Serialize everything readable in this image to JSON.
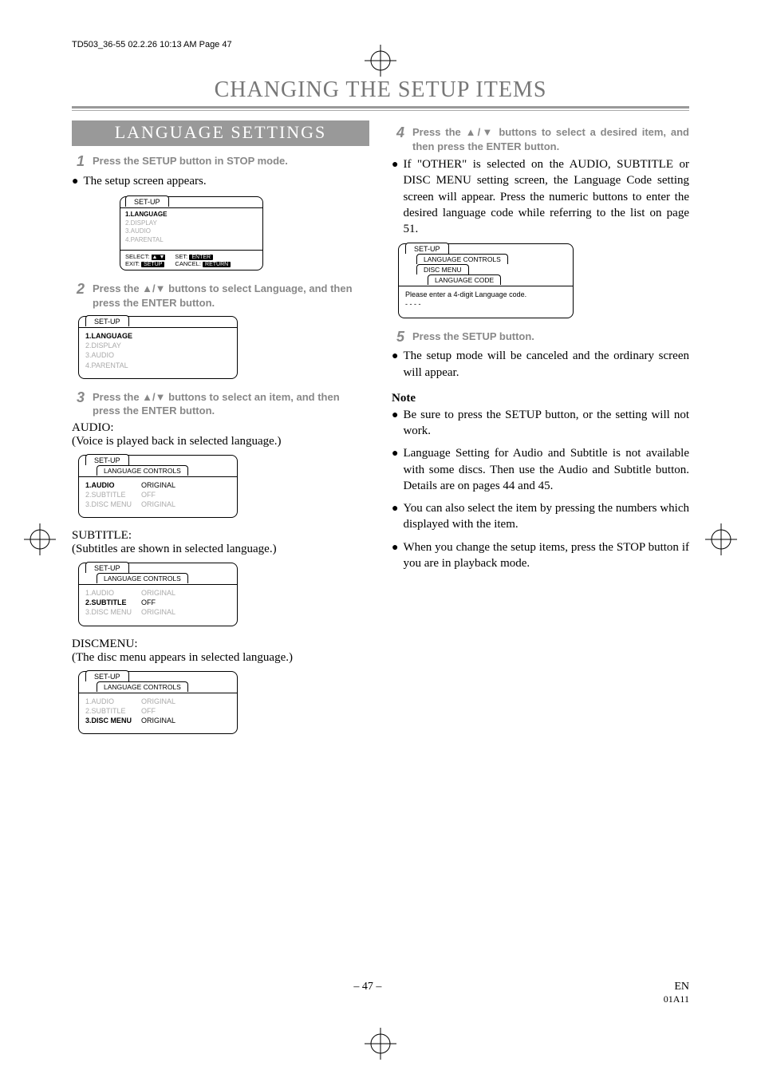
{
  "header_line": "TD503_36-55  02.2.26  10:13 AM  Page 47",
  "main_title": "CHANGING THE SETUP ITEMS",
  "banner": "LANGUAGE SETTINGS",
  "step1": {
    "num": "1",
    "text": "Press the SETUP button in STOP mode."
  },
  "bullet1": "The setup screen appears.",
  "osd_main": {
    "title": "SET-UP",
    "items": [
      "1.LANGUAGE",
      "2.DISPLAY",
      "3.AUDIO",
      "4.PARENTAL"
    ],
    "foot_select": "SELECT:",
    "foot_set": "SET:",
    "foot_exit": "EXIT:",
    "foot_cancel": "CANCEL:",
    "btn_enter": "ENTER",
    "btn_setup": "SETUP",
    "btn_return": "RETURN"
  },
  "step2": {
    "num": "2",
    "text_a": "Press the ",
    "text_b": " buttons to select Language, and then press the ENTER button."
  },
  "osd_step2": {
    "title": "SET-UP",
    "items": [
      {
        "t": "1.LANGUAGE",
        "active": true
      },
      {
        "t": "2.DISPLAY",
        "active": false
      },
      {
        "t": "3.AUDIO",
        "active": false
      },
      {
        "t": "4.PARENTAL",
        "active": false
      }
    ]
  },
  "step3": {
    "num": "3",
    "text_a": "Press the ",
    "text_b": " buttons to select an item, and then press the ENTER button."
  },
  "audio_block": {
    "label": "AUDIO:",
    "desc": "(Voice is played back in selected language.)",
    "osd_title": "SET-UP",
    "osd_sub": "LANGUAGE CONTROLS",
    "rows": [
      {
        "label": "1.AUDIO",
        "val": "ORIGINAL",
        "active": true
      },
      {
        "label": "2.SUBTITLE",
        "val": "OFF",
        "active": false
      },
      {
        "label": "3.DISC MENU",
        "val": "ORIGINAL",
        "active": false
      }
    ]
  },
  "subtitle_block": {
    "label": "SUBTITLE:",
    "desc": "(Subtitles are shown in selected language.)",
    "rows": [
      {
        "label": "1.AUDIO",
        "val": "ORIGINAL",
        "active": false
      },
      {
        "label": "2.SUBTITLE",
        "val": "OFF",
        "active": true
      },
      {
        "label": "3.DISC MENU",
        "val": "ORIGINAL",
        "active": false
      }
    ]
  },
  "discmenu_block": {
    "label": "DISCMENU:",
    "desc": "(The disc menu appears in selected language.)",
    "rows": [
      {
        "label": "1.AUDIO",
        "val": "ORIGINAL",
        "active": false
      },
      {
        "label": "2.SUBTITLE",
        "val": "OFF",
        "active": false
      },
      {
        "label": "3.DISC MENU",
        "val": "ORIGINAL",
        "active": true
      }
    ]
  },
  "step4": {
    "num": "4",
    "text_a": "Press the ",
    "text_b": " buttons to select a desired item, and then press the ENTER button."
  },
  "bullet4": "If \"OTHER\" is selected on the AUDIO, SUBTITLE or DISC MENU setting screen, the Language Code setting screen will appear. Press the numeric buttons to enter the desired language code while referring to the list on page 51.",
  "osd_code": {
    "t1": "SET-UP",
    "t2": "LANGUAGE CONTROLS",
    "t3": "DISC MENU",
    "t4": "LANGUAGE CODE",
    "prompt": "Please enter a 4-digit Language code.",
    "dashes": "- - - -"
  },
  "step5": {
    "num": "5",
    "text": "Press the SETUP button."
  },
  "bullet5": "The setup mode will be canceled and the ordinary screen will appear.",
  "note_h": "Note",
  "notes": [
    "Be sure to press the SETUP button, or the setting will not work.",
    "Language Setting for Audio and Subtitle is not available with some discs. Then use the Audio and Subtitle button. Details are on pages 44 and 45.",
    "You can also select the item by pressing the numbers which displayed with the item.",
    "When you change the setup items, press the STOP button if you are in playback mode."
  ],
  "footer": {
    "page": "– 47 –",
    "en": "EN",
    "code": "01A11"
  }
}
